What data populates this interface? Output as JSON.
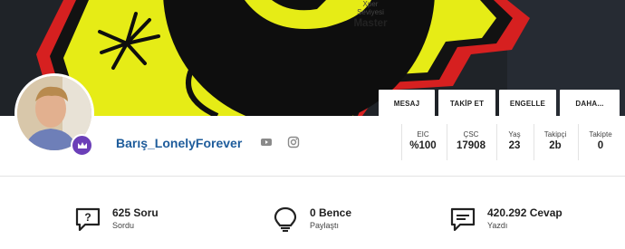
{
  "actions": {
    "message": "MESAJ",
    "follow": "TAKİP ET",
    "block": "ENGELLE",
    "more": "DAHA..."
  },
  "profile": {
    "username": "Barış_LonelyForever",
    "social": [
      "youtube-icon",
      "instagram-icon"
    ]
  },
  "stats": [
    {
      "label": "Xper Seviyesi",
      "value": "Master"
    },
    {
      "label": "EIC",
      "value": "%100"
    },
    {
      "label": "ÇSC",
      "value": "17908"
    },
    {
      "label": "Yaş",
      "value": "23"
    },
    {
      "label": "Takipçi",
      "value": "2b"
    },
    {
      "label": "Takipte",
      "value": "0"
    }
  ],
  "summary": [
    {
      "title": "625 Soru",
      "subtitle": "Sordu",
      "icon": "question-bubble-icon"
    },
    {
      "title": "0 Bence",
      "subtitle": "Paylaştı",
      "icon": "lightbulb-icon"
    },
    {
      "title": "420.292 Cevap",
      "subtitle": "Yazdı",
      "icon": "chat-bubble-icon"
    }
  ],
  "colors": {
    "accent": "#1e5c9b",
    "badge": "#6b3fb8",
    "cover_bg": "#20242a",
    "cover_yellow": "#e6ec16",
    "cover_red": "#d62020"
  }
}
